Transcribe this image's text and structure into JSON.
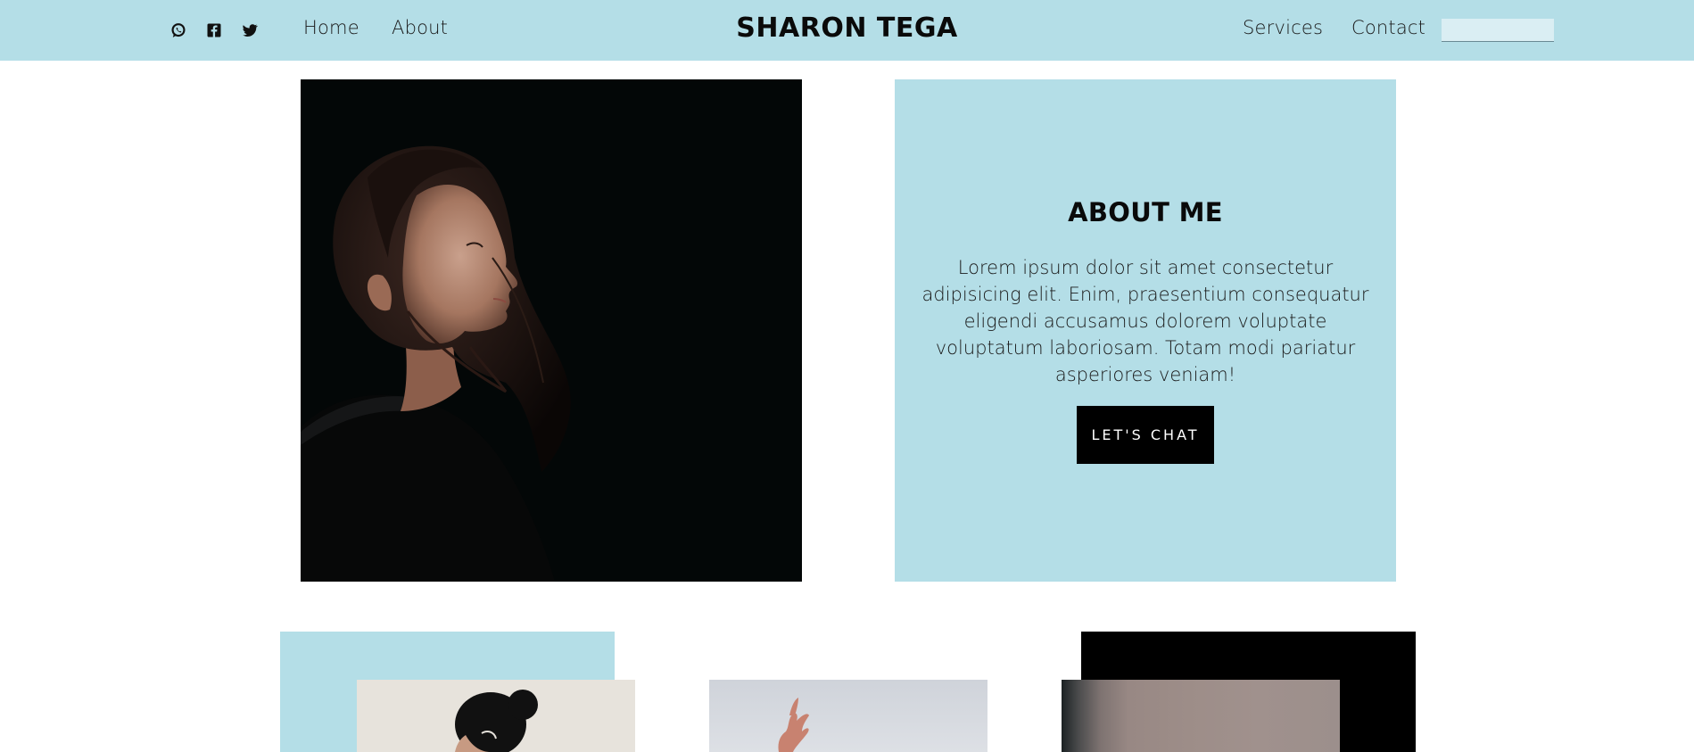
{
  "nav": {
    "brand": "SHARON TEGA",
    "links_left": [
      "Home",
      "About"
    ],
    "links_right": [
      "Services",
      "Contact"
    ],
    "social_icons": [
      "whatsapp-icon",
      "facebook-icon",
      "twitter-icon"
    ],
    "search": {
      "value": "",
      "placeholder": ""
    }
  },
  "about": {
    "title": "ABOUT ME",
    "text": "Lorem ipsum dolor sit amet consectetur adipisicing elit. Enim, praesentium consequatur eligendi accusamus dolorem voluptate voluptatum laboriosam. Totam modi pariatur asperiores veniam!",
    "button_label": "LET'S CHAT"
  },
  "colors": {
    "accent": "#b4dee7",
    "dark": "#000000",
    "background": "#ffffff"
  }
}
